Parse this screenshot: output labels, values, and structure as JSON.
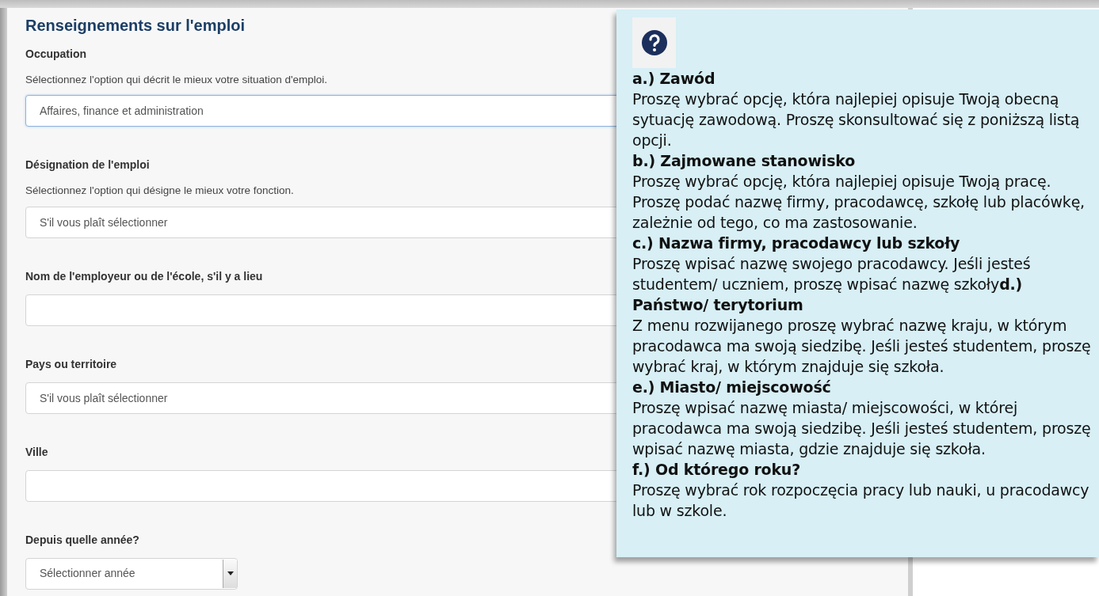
{
  "form": {
    "title": "Renseignements sur l'emploi",
    "fields": [
      {
        "kind": "select",
        "label": "Occupation",
        "description": "Sélectionnez l'option qui décrit le mieux votre situation d'emploi.",
        "value": "Affaires, finance et administration",
        "focused": true
      },
      {
        "kind": "select",
        "label": "Désignation de l'emploi",
        "description": "Sélectionnez l'option qui désigne le mieux votre fonction.",
        "value": "S'il vous plaît sélectionner",
        "focused": false
      },
      {
        "kind": "text",
        "label": "Nom de l'employeur ou de l'école, s'il y a lieu",
        "focused": false
      },
      {
        "kind": "select",
        "label": "Pays ou territoire",
        "value": "S'il vous plaît sélectionner",
        "focused": false
      },
      {
        "kind": "text",
        "label": "Ville",
        "focused": false
      },
      {
        "kind": "year",
        "label": "Depuis quelle année?",
        "value": "Sélectionner année",
        "focused": false
      }
    ]
  },
  "help_popup": {
    "sections": [
      {
        "heading": "a.) Zawód",
        "body": "Proszę wybrać opcję, która najlepiej opisuje Twoją obecną sytuację zawodową. Proszę skonsultować się z poniższą listą opcji."
      },
      {
        "heading": "b.) Zajmowane stanowisko",
        "body": "Proszę wybrać opcję, która najlepiej opisuje Twoją pracę. Proszę podać nazwę firmy, pracodawcę, szkołę lub placówkę, zależnie od tego, co ma zastosowanie."
      },
      {
        "heading": "c.) Nazwa firmy, pracodawcy lub szkoły",
        "body": "Proszę wpisać nazwę swojego pracodawcy.  Jeśli jesteś studentem/ uczniem, proszę wpisać nazwę szkoły**d.)**"
      },
      {
        "heading": "Państwo/ terytorium",
        "body": "Z menu rozwijanego proszę wybrać nazwę kraju, w którym pracodawca ma swoją siedzibę. Jeśli jesteś studentem, proszę wybrać kraj, w którym znajduje się szkoła."
      },
      {
        "heading": "e.) Miasto/ miejscowość",
        "body": "Proszę wpisać nazwę miasta/ miejscowości, w której pracodawca ma swoją siedzibę. Jeśli jesteś studentem, proszę wpisać nazwę miasta, gdzie znajduje się szkoła."
      },
      {
        "heading": "f.) Od którego roku?",
        "body": "Proszę wybrać rok rozpoczęcia pracy lub nauki, u pracodawcy lub w szkole."
      }
    ]
  }
}
